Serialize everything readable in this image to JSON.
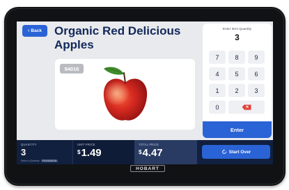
{
  "header": {
    "back_label": "Back",
    "product_title": "Organic Red Delicious Apples"
  },
  "product": {
    "plu": "94016",
    "image_icon": "red-apple-icon"
  },
  "keypad": {
    "label": "Enter Item Quantity",
    "value": "3",
    "keys": [
      "7",
      "8",
      "9",
      "4",
      "5",
      "6",
      "1",
      "2",
      "3",
      "0"
    ],
    "delete_icon": "backspace-icon",
    "enter_label": "Enter"
  },
  "footer": {
    "quantity_label": "QUANTITY",
    "quantity_value": "3",
    "tare_label": "Select a Quantity",
    "tare_badge": "PICK/ASSIGN",
    "unit_price_label": "UNIT PRICE",
    "unit_price_currency": "$",
    "unit_price_value": "1.49",
    "total_price_label": "TOTAL PRICE",
    "total_price_currency": "$",
    "total_price_value": "4.47",
    "start_over_label": "Start Over",
    "start_over_icon": "refresh-icon"
  },
  "device": {
    "brand": "HOBART"
  },
  "colors": {
    "accent_blue": "#2a63d6",
    "title_navy": "#12285a",
    "footer_navy": "#11203f",
    "delete_red": "#e2433b"
  }
}
